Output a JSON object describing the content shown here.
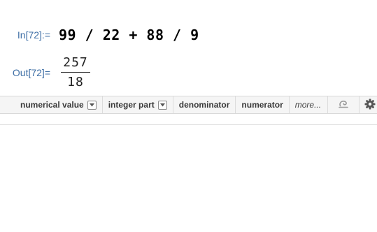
{
  "input_cell": {
    "label": "In[72]:=",
    "expression": "99 / 22 + 88 / 9"
  },
  "output_cell": {
    "label": "Out[72]=",
    "numerator": "257",
    "denominator": "18"
  },
  "suggestions_bar": {
    "items": [
      {
        "label": "numerical value",
        "has_dropdown": true
      },
      {
        "label": "integer part",
        "has_dropdown": true
      },
      {
        "label": "denominator",
        "has_dropdown": false
      },
      {
        "label": "numerator",
        "has_dropdown": false
      }
    ],
    "more_label": "more...",
    "icons": [
      "suggestions-cycle-icon",
      "gear-icon"
    ]
  }
}
